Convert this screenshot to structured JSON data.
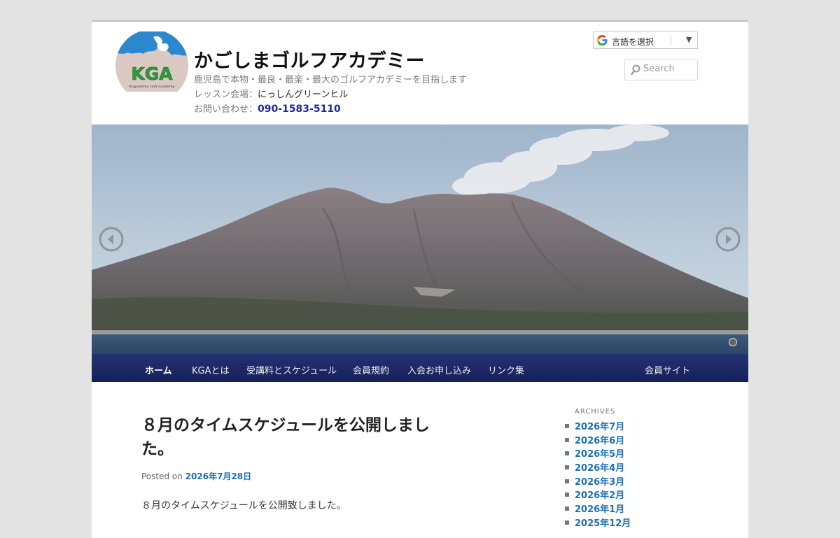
{
  "header": {
    "site_title": "かごしまゴルフアカデミー",
    "description": "鹿児島で本物・最良・最楽・最大のゴルフアカデミーを目指します",
    "venue_label": "レッスン会場：",
    "venue_value": "にっしんグリーンヒル",
    "contact_label": "お問い合わせ：",
    "contact_value": "090-1583-5110",
    "logo_text": "KGA",
    "logo_subtext": "Kagoshima Golf Academy"
  },
  "translate": {
    "label": "言語を選択",
    "arrow": "▼"
  },
  "search": {
    "placeholder": "Search"
  },
  "nav": {
    "items": [
      {
        "label": "ホーム",
        "active": true
      },
      {
        "label": "KGAとは"
      },
      {
        "label": "受講料とスケジュール"
      },
      {
        "label": "会員規約"
      },
      {
        "label": "入会お申し込み"
      },
      {
        "label": "リンク集"
      },
      {
        "label": "会員サイト"
      }
    ]
  },
  "post": {
    "title": "８月のタイムスケジュールを公開しました。",
    "posted_label": "Posted on",
    "posted_date": "2026年7月28日",
    "body": "８月のタイムスケジュールを公開致しました。"
  },
  "sidebar": {
    "archives_heading": "ARCHIVES",
    "archives": [
      "2026年7月",
      "2026年6月",
      "2026年5月",
      "2026年4月",
      "2026年3月",
      "2026年2月",
      "2026年1月",
      "2025年12月"
    ]
  },
  "colors": {
    "nav_bg": "#1c2665",
    "link": "#1b6fb5",
    "phone": "#1b2a9e",
    "page_bg": "#e3e3e3"
  },
  "icons": {
    "prev": "chevron-left-circle-icon",
    "next": "chevron-right-circle-icon",
    "search": "search-icon",
    "translate": "google-g-icon"
  }
}
